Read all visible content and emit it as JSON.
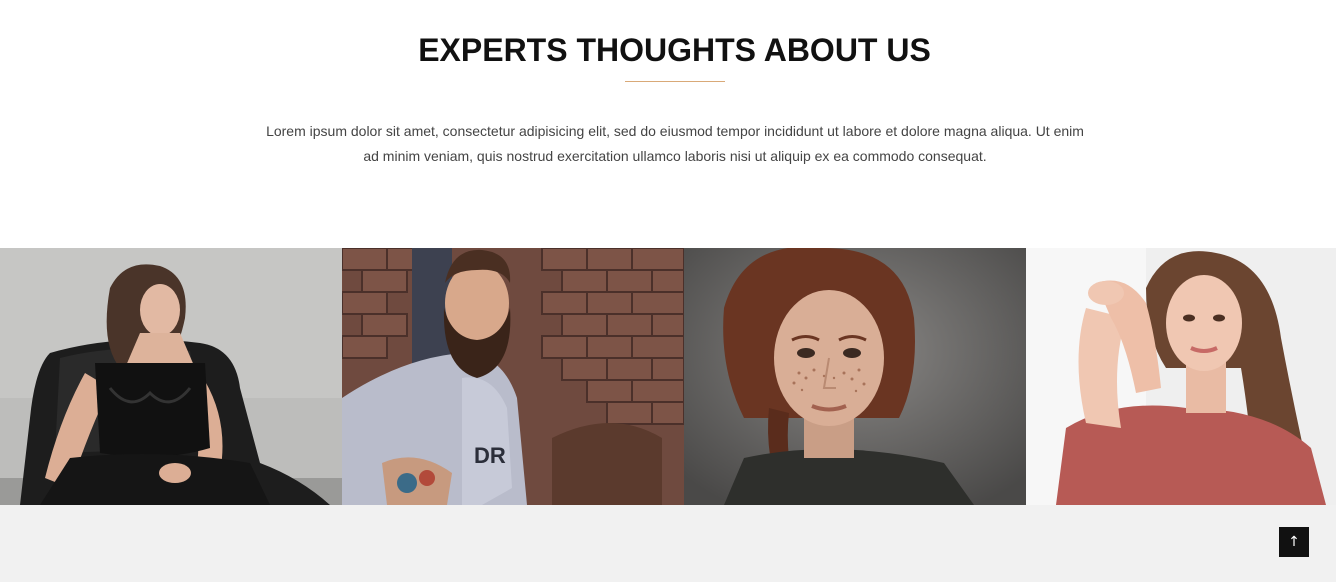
{
  "section": {
    "title": "EXPERTS THOUGHTS ABOUT US",
    "intro_line1": "Lorem ipsum dolor sit amet, consectetur adipisicing elit, sed do eiusmod tempor incididunt ut labore et dolore magna aliqua. Ut enim",
    "intro_line2": "ad minim veniam, quis nostrud exercitation ullamco laboris nisi ut aliquip ex ea commodo consequat.",
    "divider_color": "#d9a978"
  },
  "gallery": {
    "photos": [
      {
        "name": "woman-black-lace-chair-photo"
      },
      {
        "name": "bearded-man-brick-wall-photo"
      },
      {
        "name": "freckled-woman-portrait-photo"
      },
      {
        "name": "woman-red-top-portrait-photo"
      }
    ]
  },
  "footer": {
    "background": "#f1f1f1",
    "back_to_top_icon": "arrow-up-icon",
    "back_to_top_glyph": "↑"
  }
}
